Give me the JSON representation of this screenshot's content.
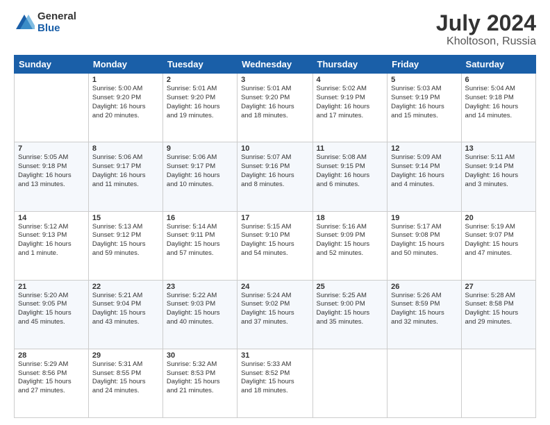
{
  "logo": {
    "general": "General",
    "blue": "Blue"
  },
  "title": "July 2024",
  "subtitle": "Kholtoson, Russia",
  "weekdays": [
    "Sunday",
    "Monday",
    "Tuesday",
    "Wednesday",
    "Thursday",
    "Friday",
    "Saturday"
  ],
  "weeks": [
    [
      {
        "day": "",
        "info": ""
      },
      {
        "day": "1",
        "info": "Sunrise: 5:00 AM\nSunset: 9:20 PM\nDaylight: 16 hours\nand 20 minutes."
      },
      {
        "day": "2",
        "info": "Sunrise: 5:01 AM\nSunset: 9:20 PM\nDaylight: 16 hours\nand 19 minutes."
      },
      {
        "day": "3",
        "info": "Sunrise: 5:01 AM\nSunset: 9:20 PM\nDaylight: 16 hours\nand 18 minutes."
      },
      {
        "day": "4",
        "info": "Sunrise: 5:02 AM\nSunset: 9:19 PM\nDaylight: 16 hours\nand 17 minutes."
      },
      {
        "day": "5",
        "info": "Sunrise: 5:03 AM\nSunset: 9:19 PM\nDaylight: 16 hours\nand 15 minutes."
      },
      {
        "day": "6",
        "info": "Sunrise: 5:04 AM\nSunset: 9:18 PM\nDaylight: 16 hours\nand 14 minutes."
      }
    ],
    [
      {
        "day": "7",
        "info": "Sunrise: 5:05 AM\nSunset: 9:18 PM\nDaylight: 16 hours\nand 13 minutes."
      },
      {
        "day": "8",
        "info": "Sunrise: 5:06 AM\nSunset: 9:17 PM\nDaylight: 16 hours\nand 11 minutes."
      },
      {
        "day": "9",
        "info": "Sunrise: 5:06 AM\nSunset: 9:17 PM\nDaylight: 16 hours\nand 10 minutes."
      },
      {
        "day": "10",
        "info": "Sunrise: 5:07 AM\nSunset: 9:16 PM\nDaylight: 16 hours\nand 8 minutes."
      },
      {
        "day": "11",
        "info": "Sunrise: 5:08 AM\nSunset: 9:15 PM\nDaylight: 16 hours\nand 6 minutes."
      },
      {
        "day": "12",
        "info": "Sunrise: 5:09 AM\nSunset: 9:14 PM\nDaylight: 16 hours\nand 4 minutes."
      },
      {
        "day": "13",
        "info": "Sunrise: 5:11 AM\nSunset: 9:14 PM\nDaylight: 16 hours\nand 3 minutes."
      }
    ],
    [
      {
        "day": "14",
        "info": "Sunrise: 5:12 AM\nSunset: 9:13 PM\nDaylight: 16 hours\nand 1 minute."
      },
      {
        "day": "15",
        "info": "Sunrise: 5:13 AM\nSunset: 9:12 PM\nDaylight: 15 hours\nand 59 minutes."
      },
      {
        "day": "16",
        "info": "Sunrise: 5:14 AM\nSunset: 9:11 PM\nDaylight: 15 hours\nand 57 minutes."
      },
      {
        "day": "17",
        "info": "Sunrise: 5:15 AM\nSunset: 9:10 PM\nDaylight: 15 hours\nand 54 minutes."
      },
      {
        "day": "18",
        "info": "Sunrise: 5:16 AM\nSunset: 9:09 PM\nDaylight: 15 hours\nand 52 minutes."
      },
      {
        "day": "19",
        "info": "Sunrise: 5:17 AM\nSunset: 9:08 PM\nDaylight: 15 hours\nand 50 minutes."
      },
      {
        "day": "20",
        "info": "Sunrise: 5:19 AM\nSunset: 9:07 PM\nDaylight: 15 hours\nand 47 minutes."
      }
    ],
    [
      {
        "day": "21",
        "info": "Sunrise: 5:20 AM\nSunset: 9:05 PM\nDaylight: 15 hours\nand 45 minutes."
      },
      {
        "day": "22",
        "info": "Sunrise: 5:21 AM\nSunset: 9:04 PM\nDaylight: 15 hours\nand 43 minutes."
      },
      {
        "day": "23",
        "info": "Sunrise: 5:22 AM\nSunset: 9:03 PM\nDaylight: 15 hours\nand 40 minutes."
      },
      {
        "day": "24",
        "info": "Sunrise: 5:24 AM\nSunset: 9:02 PM\nDaylight: 15 hours\nand 37 minutes."
      },
      {
        "day": "25",
        "info": "Sunrise: 5:25 AM\nSunset: 9:00 PM\nDaylight: 15 hours\nand 35 minutes."
      },
      {
        "day": "26",
        "info": "Sunrise: 5:26 AM\nSunset: 8:59 PM\nDaylight: 15 hours\nand 32 minutes."
      },
      {
        "day": "27",
        "info": "Sunrise: 5:28 AM\nSunset: 8:58 PM\nDaylight: 15 hours\nand 29 minutes."
      }
    ],
    [
      {
        "day": "28",
        "info": "Sunrise: 5:29 AM\nSunset: 8:56 PM\nDaylight: 15 hours\nand 27 minutes."
      },
      {
        "day": "29",
        "info": "Sunrise: 5:31 AM\nSunset: 8:55 PM\nDaylight: 15 hours\nand 24 minutes."
      },
      {
        "day": "30",
        "info": "Sunrise: 5:32 AM\nSunset: 8:53 PM\nDaylight: 15 hours\nand 21 minutes."
      },
      {
        "day": "31",
        "info": "Sunrise: 5:33 AM\nSunset: 8:52 PM\nDaylight: 15 hours\nand 18 minutes."
      },
      {
        "day": "",
        "info": ""
      },
      {
        "day": "",
        "info": ""
      },
      {
        "day": "",
        "info": ""
      }
    ]
  ]
}
